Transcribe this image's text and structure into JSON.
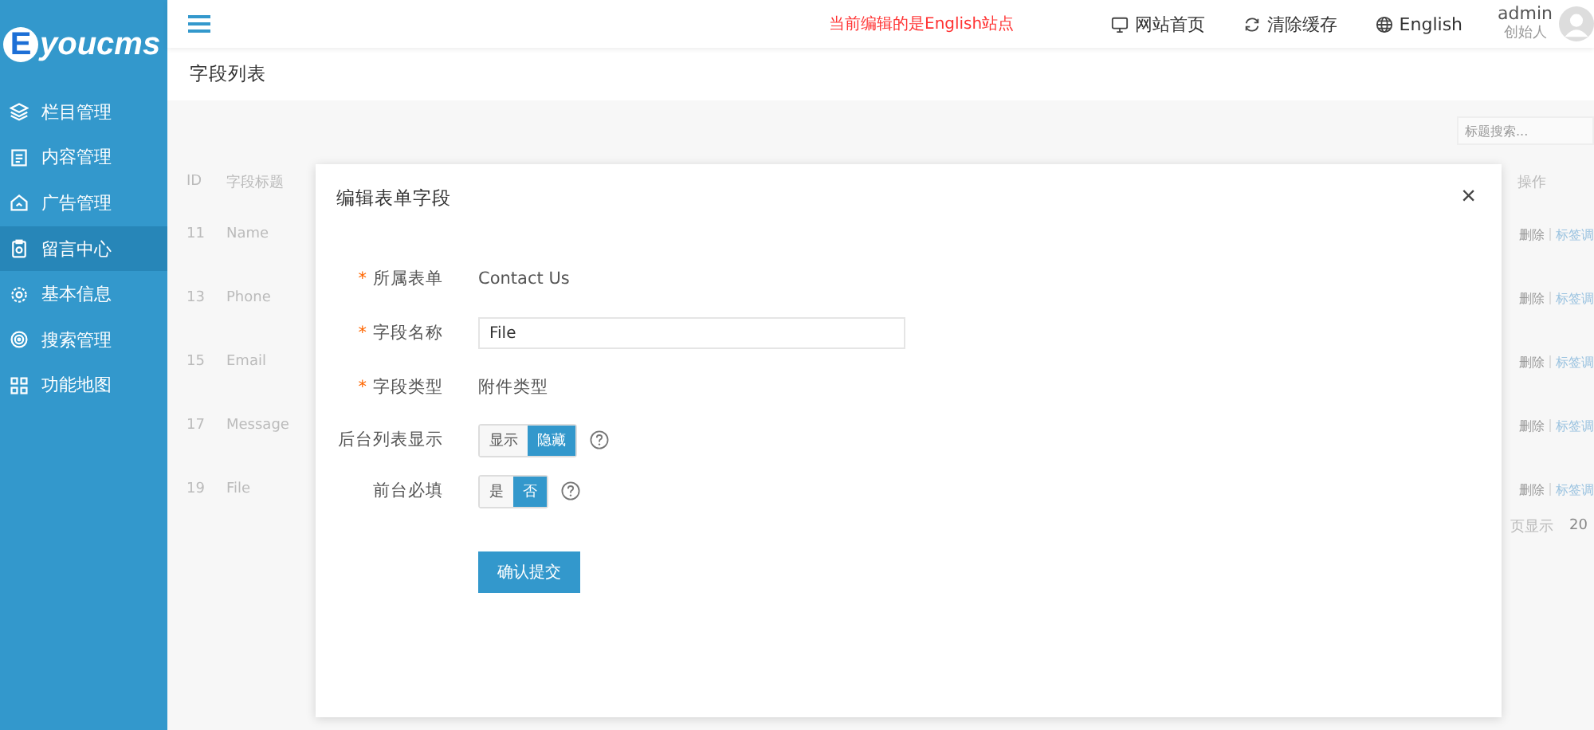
{
  "logo": {
    "badge": "E",
    "text": "youcms"
  },
  "sidebar": {
    "items": [
      {
        "label": "栏目管理",
        "selected": false
      },
      {
        "label": "内容管理",
        "selected": false
      },
      {
        "label": "广告管理",
        "selected": false
      },
      {
        "label": "留言中心",
        "selected": true
      },
      {
        "label": "基本信息",
        "selected": false
      },
      {
        "label": "搜索管理",
        "selected": false
      },
      {
        "label": "功能地图",
        "selected": false
      }
    ]
  },
  "topbar": {
    "notice": "当前编辑的是English站点",
    "links": [
      "网站首页",
      "清除缓存",
      "English"
    ],
    "user": {
      "name": "admin",
      "role": "创始人"
    }
  },
  "page": {
    "title": "字段列表",
    "search": {
      "placeholder": "标题搜索..."
    },
    "table": {
      "columns": [
        "ID",
        "字段标题",
        "操作"
      ],
      "rows": [
        {
          "id": "11",
          "title": "Name",
          "actions": [
            "删除",
            "标签调"
          ]
        },
        {
          "id": "13",
          "title": "Phone",
          "actions": [
            "删除",
            "标签调"
          ]
        },
        {
          "id": "15",
          "title": "Email",
          "actions": [
            "删除",
            "标签调"
          ]
        },
        {
          "id": "17",
          "title": "Message",
          "actions": [
            "删除",
            "标签调"
          ]
        },
        {
          "id": "19",
          "title": "File",
          "actions": [
            "删除",
            "标签调"
          ]
        }
      ]
    },
    "pagination": {
      "label": "页显示",
      "value": "20"
    }
  },
  "dialog": {
    "title": "编辑表单字段",
    "close": "×",
    "fields": [
      {
        "kind": "text",
        "label": "所属表单",
        "required_mark": "*",
        "value": "Contact Us"
      },
      {
        "kind": "input",
        "label": "字段名称",
        "required_mark": "*",
        "value": "File"
      },
      {
        "kind": "text",
        "label": "字段类型",
        "required_mark": "*",
        "value": "附件类型"
      },
      {
        "kind": "toggle",
        "label": "后台列表显示",
        "options": [
          {
            "label": "显示",
            "selected": false
          },
          {
            "label": "隐藏",
            "selected": true
          }
        ]
      },
      {
        "kind": "toggle",
        "label": "前台必填",
        "options": [
          {
            "label": "是",
            "selected": false
          },
          {
            "label": "否",
            "selected": true
          }
        ]
      }
    ],
    "submit": "确认提交"
  }
}
